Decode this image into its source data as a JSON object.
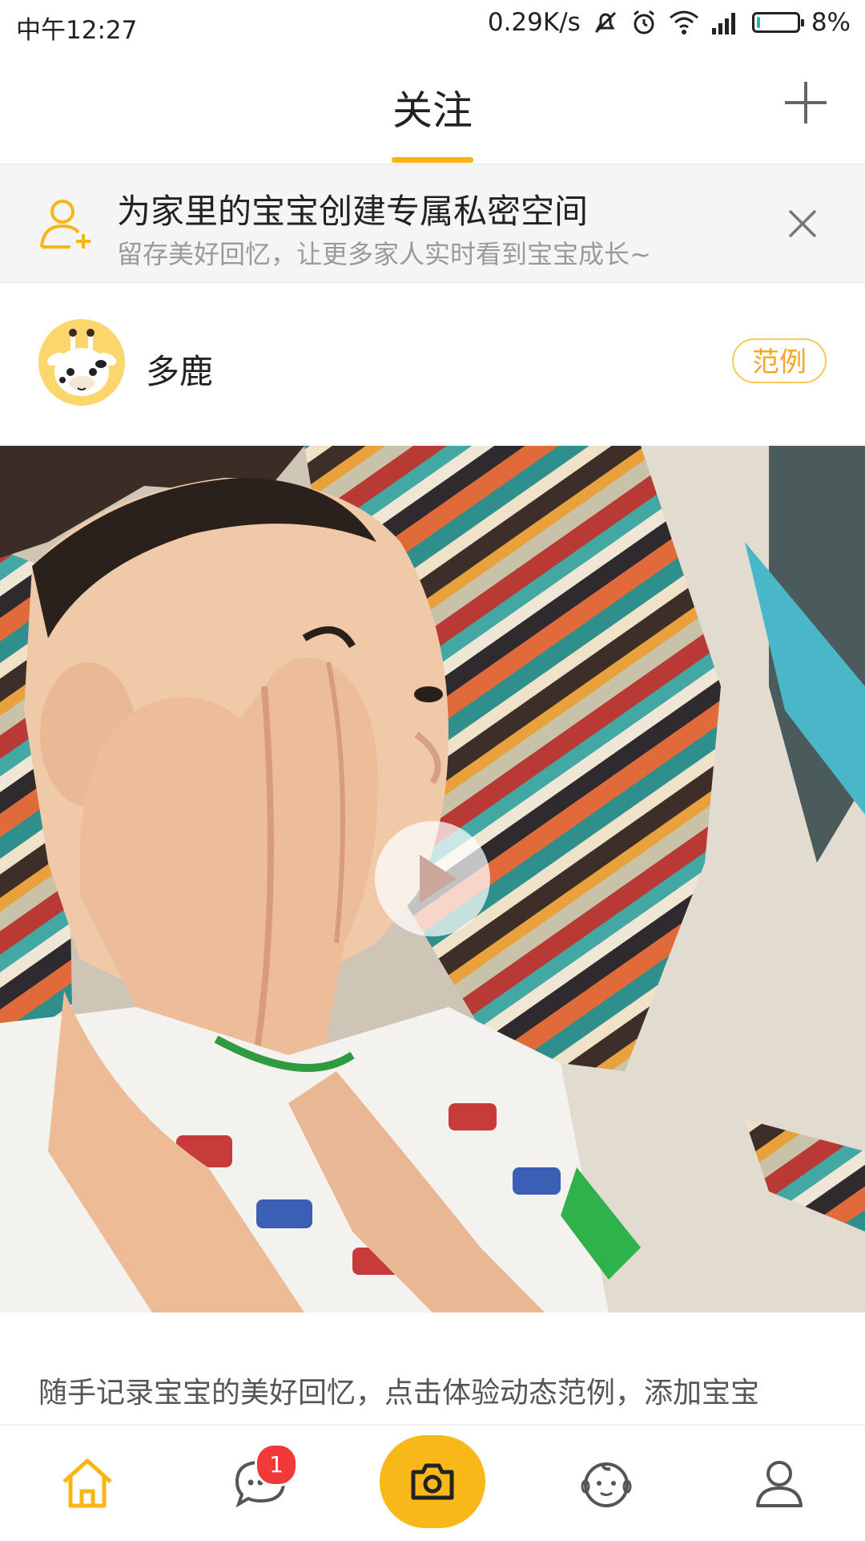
{
  "status_bar": {
    "time": "中午12:27",
    "net_speed": "0.29K/s",
    "battery_percent": "8%",
    "battery_level": 0.08
  },
  "header": {
    "tab_label": "关注",
    "add_icon": "plus-icon"
  },
  "banner": {
    "title": "为家里的宝宝创建专属私密空间",
    "subtitle": "留存美好回忆，让更多家人实时看到宝宝成长~",
    "icon": "user-plus-icon",
    "close_icon": "close-icon"
  },
  "post": {
    "author": "多鹿",
    "example_label": "范例",
    "media_type": "video",
    "caption": "随手记录宝宝的美好回忆，点击体验动态范例，添加宝宝"
  },
  "bottom_nav": {
    "items": [
      {
        "name": "home",
        "icon": "home-icon",
        "active": true
      },
      {
        "name": "messages",
        "icon": "chat-icon",
        "badge": "1"
      },
      {
        "name": "camera",
        "icon": "camera-icon"
      },
      {
        "name": "baby",
        "icon": "baby-face-icon"
      },
      {
        "name": "profile",
        "icon": "person-icon"
      }
    ]
  },
  "colors": {
    "accent": "#f7b616",
    "badge": "#f2393a",
    "subtitle": "#9a9a9a"
  }
}
